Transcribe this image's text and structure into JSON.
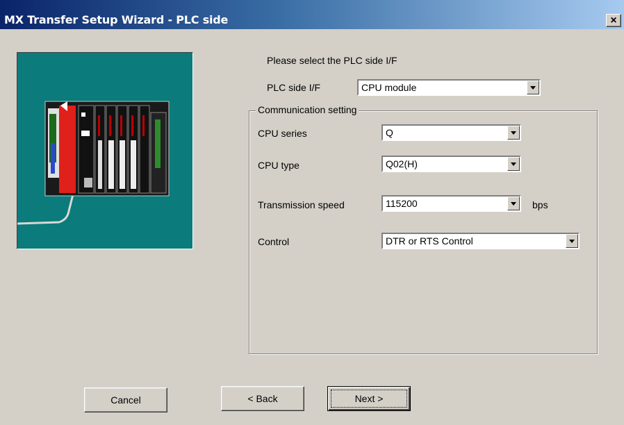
{
  "window": {
    "title": "MX Transfer Setup Wizard - PLC side",
    "close_label": "×"
  },
  "prompt": "Please select the PLC side I/F",
  "plc_side_if": {
    "label": "PLC side I/F",
    "value": "CPU module"
  },
  "communication": {
    "legend": "Communication setting",
    "cpu_series": {
      "label": "CPU series",
      "value": "Q"
    },
    "cpu_type": {
      "label": "CPU type",
      "value": "Q02(H)"
    },
    "transmission_speed": {
      "label": "Transmission speed",
      "value": "115200",
      "unit": "bps"
    },
    "control": {
      "label": "Control",
      "value": "DTR or RTS Control"
    }
  },
  "buttons": {
    "cancel": "Cancel",
    "back": "< Back",
    "next": "Next >"
  },
  "colors": {
    "panel_bg": "#0b7b7b",
    "dialog_bg": "#d4d0c8",
    "title_start": "#0a246a",
    "title_end": "#a6caf0"
  }
}
